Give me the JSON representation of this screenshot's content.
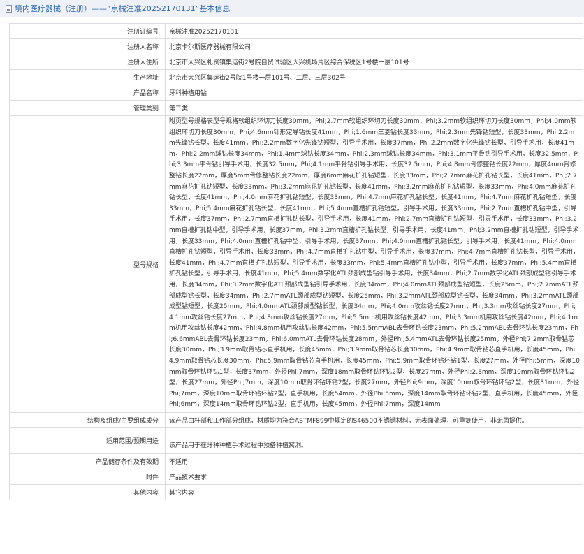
{
  "header": {
    "title": "境内医疗器械（注册）——“京械注准20252170131”基本信息"
  },
  "rows": [
    {
      "label": "注册证编号",
      "value": "京械注准20252170131"
    },
    {
      "label": "注册人名称",
      "value": "北京卡尔斯医疗器械有限公司"
    },
    {
      "label": "注册人住所",
      "value": "北京市大兴区礼贤镇集运街2号院自贸试验区大兴机场片区综合保税区1号楼一层101号"
    },
    {
      "label": "生产地址",
      "value": "北京市大兴区集运街2号院1号楼一层101号、二层、三层302号"
    },
    {
      "label": "产品名称",
      "value": "牙科种植用钻"
    },
    {
      "label": "管理类别",
      "value": "第二类"
    },
    {
      "label": "型号规格",
      "value": "附页型号规格表型号规格软组织环切刀长度30mm，Phi;2.7mm软组织环切刀长度30mm，Phi;3.2mm软组织环切刀长度30mm，Phi;4.0mm软组织环切刀长度30mm，Phi;4.6mm针形定导钻长度41mm，Phi;1.6mm三菱钻长度33mm，Phi;2.3mm先锋钻短型，长度33mm，Phi;2.2mm先锋钻长型，长度41mm，Phi;2.2mm数字化先锋钻短型，引导手术用，长度37mm，Phi;2.2mm数字化先锋钻长型，引导手术用，长度41mm，Phi;2.2mm球钻长度34mm，Phi;1.4mm球钻长度34mm，Phi;2.3mm球钻长度34mm，Phi;3.1mm平骨钻引导手术用，长度32.5mm，Phi;3.3mm平骨钻引导手术用，长度32.5mm，Phi;4.1mm平骨钻引导手术用，长度32.5mm，Phi;4.8mm骨修整钻长度22mm，厚度4mm骨修整钻长度22mm，厚度5mm骨修整钻长度22mm，厚度6mm麻花扩孔钻短型，长度33mm，Phi;2.7mm麻花扩孔钻长型，长度41mm，Phi;2.7mm麻花扩孔钻短型，长度33mm，Phi;3.2mm麻花扩孔钻长型，长度41mm，Phi;3.2mm麻花扩孔钻短型，长度33mm，Phi;4.0mm麻花扩孔钻长型，长度41mm，Phi;4.0mm麻花扩孔钻短型，长度33mm，Phi;4.7mm麻花扩孔钻长型，长度41mm，Phi;4.7mm麻花扩孔钻短型，长度33mm，Phi;5.4mm麻花扩孔钻长型，长度41mm，Phi;5.4mm直槽扩孔钻短型，引导手术用，长度33mm，Phi;2.7mm直槽扩孔钻中型，引导手术用，长度37mm，Phi;2.7mm直槽扩孔钻长型，引导手术用，长度41mm，Phi;2.7mm直槽扩孔钻短型，引导手术用，长度33mm，Phi;3.2mm直槽扩孔钻中型，引导手术用，长度37mm，Phi;3.2mm直槽扩孔钻长型，引导手术用，长度41mm，Phi;3.2mm直槽扩孔钻短型，引导手术用，长度33mm，Phi;4.0mm直槽扩孔钻中型，引导手术用，长度37mm，Phi;4.0mm直槽扩孔钻长型，引导手术用，长度41mm，Phi;4.0mm直槽扩孔钻短型，引导手术用，长度33mm，Phi;4.7mm直槽扩孔钻中型，引导手术用，长度37mm，Phi;4.7mm直槽扩孔钻长型，引导手术用，长度41mm，Phi;4.7mm直槽扩孔钻短型，引导手术用，长度33mm，Phi;5.4mm直槽扩孔钻中型，引导手术用，长度37mm，Phi;5.4mm直槽扩孔钻长型，引导手术用，长度41mm，Phi;5.4mm数字化ATL颈部成型钻引导手术用，长度34mm，Phi;2.7mm数字化ATL颈部成型钻引导手术用，长度34mm，Phi;3.2mm数字化ATL颈部成型钻引导手术用，长度34mm，Phi;4.0mmATL颈部成型钻短型，长度25mm，Phi;2.7mmATL颈部成型钻长型，长度34mm，Phi;2.7mmATL颈部成型钻短型，长度25mm，Phi;3.2mmATL颈部成型钻长型，长度34mm，Phi;3.2mmATL颈部成型钻短型，长度25mm，Phi;4.0mmATL颈部成型钻长型，长度34mm，Phi;4.0mm攻丝钻长度27mm，Phi;3.3mm攻丝钻长度27mm，Phi;4.1mm攻丝钻长度27mm，Phi;4.8mm攻丝钻长度27mm，Phi;5.5mm机用攻丝钻长度42mm，Phi;3.3mm机用攻丝钻长度42mm，Phi;4.1mm机用攻丝钻长度42mm，Phi;4.8mm机用攻丝钻长度42mm，Phi;5.5mmABL去骨环钻长度23mm，Phi;5.2mmABL去骨环钻长度23mm，Phi;6.6mmABL去骨环钻长度23mm，Phi;6.0mmATL去骨环钻长度28mm，外径Phi;5.4mmATL去骨环钻长度25mm，外径Phi;7.2mm取骨钻芯长度30mm，Phi;3.9mm取骨钻芯直手机用，长度45mm，Phi;3.9mm取骨钻芯长度30mm，Phi;4.9mm取骨钻芯直手机用，长度45mm，Phi;4.9mm取骨钻芯长度30mm，Phi;5.9mm取骨钻芯直手机用，长度45mm，Phi;5.9mm取骨环钻环钻1型，长度27mm，外径Phi;5mm，深度10mm取骨环钻环钻1型，长度37mm，外径Phi;7mm，深度18mm取骨环钻环钻2型，长度27mm，外径Phi;2.8mm，深度10mm取骨环钻环钻2型，长度27mm，外径Phi;7mm，深度10mm取骨环钻环钻2型，长度27mm，外径Phi;9mm，深度10mm取骨环钻环钻2型，长度31mm，外径Phi;7mm，深度10mm取骨环钻环钻2型，直手机用，长度54mm，外径Phi;5mm，深度14mm取骨环钻环钻2型，直手机用，长度45mm，外径Phi;6mm，深度14mm取骨环钻环钻2型，直手机用，长度45mm，外径Phi;7mm，深度14mm"
    },
    {
      "label": "结构及组成/主要组成成分",
      "value": "该产品由杆部和工作部分组成，材质均为符合ASTMF899中规定的S46500不锈钢材料，无表面处理，可重复使用，非无菌提供。"
    },
    {
      "label": "适用范围/预期用途",
      "value": "该产品用于在牙种种植手术过程中预备种植窝洞。"
    },
    {
      "label": "产品储存条件及有效期",
      "value": "不适用"
    },
    {
      "label": "附件",
      "value": "产品技术要求"
    },
    {
      "label": "其他内容",
      "value": "其它内容"
    }
  ]
}
